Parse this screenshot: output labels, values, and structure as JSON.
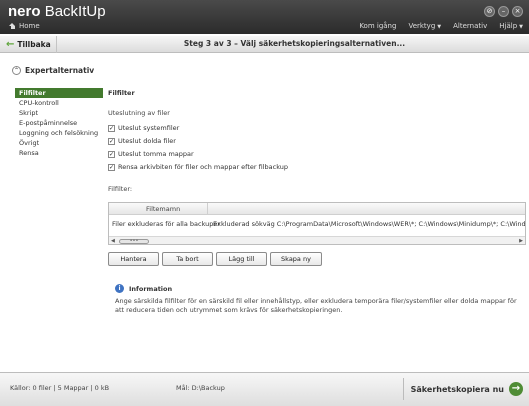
{
  "app": {
    "logo_brand": "nero",
    "logo_product": "BackItUp",
    "home_label": "Home"
  },
  "titlebar": {
    "menu": [
      {
        "label": "Kom igång"
      },
      {
        "label": "Verktyg"
      },
      {
        "label": "Alternativ"
      },
      {
        "label": "Hjälp"
      }
    ],
    "window_buttons": [
      "⊘",
      "–",
      "×"
    ]
  },
  "header": {
    "back_label": "Tillbaka",
    "step_title": "Steg 3 av 3 – Välj säkerhetskopieringsalternativen..."
  },
  "expert": {
    "label": "Expertalternativ"
  },
  "sidebar": {
    "items": [
      {
        "label": "Filfilter",
        "active": true
      },
      {
        "label": "CPU-kontroll"
      },
      {
        "label": "Skript"
      },
      {
        "label": "E-postpåminnelse"
      },
      {
        "label": "Loggning och felsökning"
      },
      {
        "label": "Övrigt"
      },
      {
        "label": "Rensa"
      }
    ]
  },
  "filefilter": {
    "title": "Filfilter",
    "exclusion_heading": "Uteslutning av filer",
    "checks": [
      {
        "label": "Uteslut systemfiler",
        "checked": true
      },
      {
        "label": "Uteslut dolda filer",
        "checked": true
      },
      {
        "label": "Uteslut tomma mappar",
        "checked": true
      },
      {
        "label": "Rensa arkivbiten för filer och mappar efter filbackup",
        "checked": true
      }
    ],
    "filters_label": "Filfilter:",
    "table": {
      "header": "Filtemamn",
      "row_name": "Filer exkluderas för alla backuper",
      "row_value": "Exkluderad sökväg C:\\ProgramData\\Microsoft\\Windows\\WER\\*; C:\\Windows\\Minidump\\*; C:\\Windows\\memo"
    },
    "buttons": [
      "Hantera",
      "Ta bort",
      "Lägg till",
      "Skapa ny"
    ],
    "info_title": "Information",
    "info_text": "Ange särskilda filfilter för en särskild fil eller innehållstyp, eller exkludera temporära filer/systemfiler eller dolda mappar för att reducera tiden och utrymmet som krävs för säkerhetskopieringen."
  },
  "footer": {
    "source": "Källor: 0 filer | 5 Mappar | 0 kB",
    "destination": "Mål: D:\\Backup",
    "go_label": "Säkerhetskopiera nu"
  }
}
